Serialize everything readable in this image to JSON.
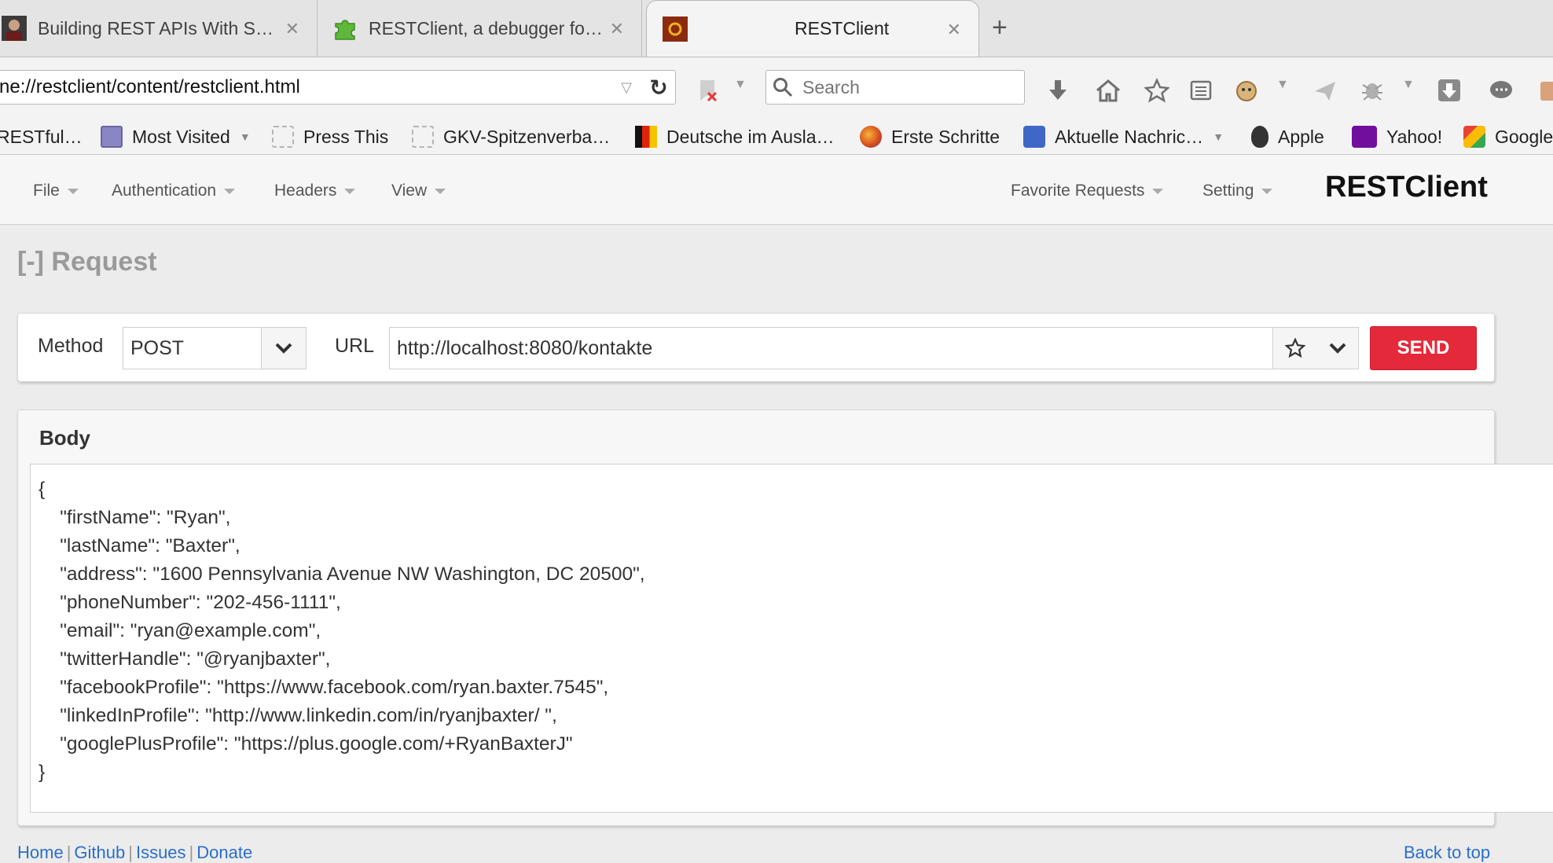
{
  "browser": {
    "tabs": [
      {
        "title": "Building REST APIs With Sp…",
        "icon": "person-avatar-icon",
        "active": false
      },
      {
        "title": "RESTClient, a debugger for …",
        "icon": "puzzle-icon",
        "active": false
      },
      {
        "title": "RESTClient",
        "icon": "restclient-logo-icon",
        "active": true
      }
    ],
    "address": "ne://restclient/content/restclient.html",
    "search_placeholder": "Search",
    "bookmarks": [
      {
        "label": "RESTful…",
        "icon": "none",
        "has_menu": false
      },
      {
        "label": "Most Visited",
        "icon": "star-folder-icon",
        "has_menu": true
      },
      {
        "label": "Press This",
        "icon": "dashed-page-icon",
        "has_menu": false
      },
      {
        "label": "GKV-Spitzenverba…",
        "icon": "dashed-page-icon",
        "has_menu": false
      },
      {
        "label": "Deutsche im Ausla…",
        "icon": "flag-icon",
        "has_menu": false
      },
      {
        "label": "Erste Schritte",
        "icon": "firefox-icon",
        "has_menu": false
      },
      {
        "label": "Aktuelle Nachric…",
        "icon": "rss-icon",
        "has_menu": true
      },
      {
        "label": "Apple",
        "icon": "apple-icon",
        "has_menu": false
      },
      {
        "label": "Yahoo!",
        "icon": "yahoo-icon",
        "has_menu": false
      },
      {
        "label": "Google",
        "icon": "google-icon",
        "has_menu": false
      }
    ]
  },
  "app": {
    "brand": "RESTClient",
    "menus": {
      "file": "File",
      "authentication": "Authentication",
      "headers": "Headers",
      "view": "View",
      "favorites": "Favorite Requests",
      "setting": "Setting"
    },
    "request": {
      "heading": "[-] Request",
      "method_label": "Method",
      "method_value": "POST",
      "url_label": "URL",
      "url_value": "http://localhost:8080/kontakte",
      "send_label": "SEND"
    },
    "body": {
      "title": "Body",
      "lines": [
        "{",
        "    \"firstName\": \"Ryan\",",
        "    \"lastName\": \"Baxter\",",
        "    \"address\": \"1600 Pennsylvania Avenue NW Washington, DC 20500\",",
        "    \"phoneNumber\": \"202-456-1111\",",
        "    \"email\": \"ryan@example.com\",",
        "    \"twitterHandle\": \"@ryanjbaxter\",",
        "    \"facebookProfile\": \"https://www.facebook.com/ryan.baxter.7545\",",
        "    \"linkedInProfile\": \"http://www.linkedin.com/in/ryanjbaxter/ \",",
        "    \"googlePlusProfile\": \"https://plus.google.com/+RyanBaxterJ\"",
        "}"
      ]
    },
    "footer": {
      "home": "Home",
      "github": "Github",
      "issues": "Issues",
      "donate": "Donate",
      "back_to_top": "Back to top"
    }
  },
  "colors": {
    "send_button": "#e4293b",
    "heading_gray": "#9a9a9a",
    "link_blue": "#2a6ec9"
  }
}
